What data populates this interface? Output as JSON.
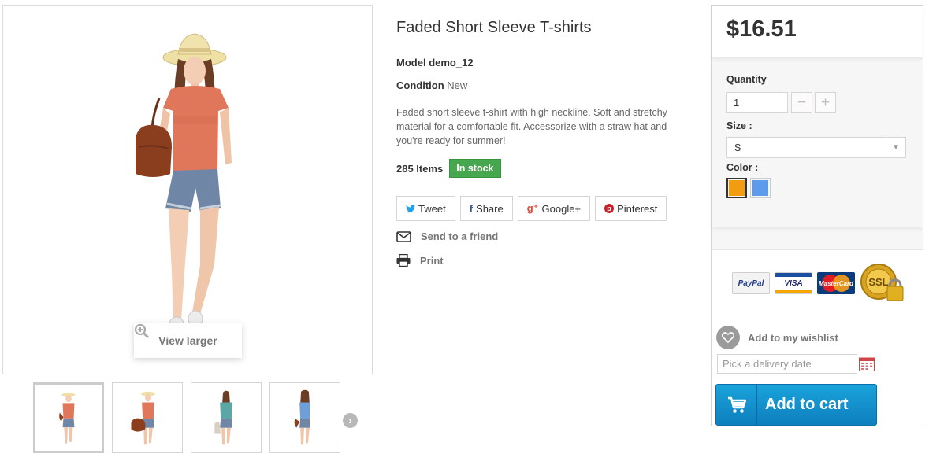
{
  "product": {
    "title": "Faded Short Sleeve T-shirts",
    "model_label": "Model",
    "model_value": "demo_12",
    "condition_label": "Condition",
    "condition_value": "New",
    "description": "Faded short sleeve t-shirt with high neckline. Soft and stretchy material for a comfortable fit. Accessorize with a straw hat and you're ready for summer!",
    "items_count": "285 Items",
    "stock_badge": "In stock",
    "stock_color": "#46a74e"
  },
  "gallery": {
    "view_larger": "View larger",
    "thumbs": [
      {
        "name": "coral-top",
        "top_color": "#e0775a"
      },
      {
        "name": "coral-top-bag",
        "top_color": "#e0775a"
      },
      {
        "name": "teal-top",
        "top_color": "#5aa7a5"
      },
      {
        "name": "blue-top",
        "top_color": "#6f9fd8"
      }
    ]
  },
  "social": {
    "tweet": "Tweet",
    "share": "Share",
    "google_plus": "Google+",
    "pinterest": "Pinterest"
  },
  "links": {
    "send_to_friend": "Send to a friend",
    "print": "Print"
  },
  "buy": {
    "price": "$16.51",
    "quantity_label": "Quantity",
    "quantity_value": "1",
    "minus": "−",
    "plus": "+",
    "size_label": "Size :",
    "size_value": "S",
    "color_label": "Color :",
    "colors": [
      "#f39c11",
      "#5d9cec"
    ],
    "wishlist": "Add to my wishlist",
    "delivery_placeholder": "Pick a delivery date",
    "add_to_cart": "Add to cart"
  },
  "payment": {
    "paypal": "PayPal",
    "visa": "VISA",
    "mastercard": "MasterCard",
    "ssl": "SSL"
  },
  "icons": {
    "tweet": "twitter-bird-icon",
    "share": "facebook-f-icon",
    "google": "google-plus-icon",
    "pinterest": "pinterest-p-icon",
    "mail": "envelope-icon",
    "print": "printer-icon",
    "zoom": "zoom-in-icon",
    "heart": "heart-icon",
    "calendar": "calendar-icon",
    "cart": "shopping-cart-icon",
    "next": "chevron-right-icon"
  }
}
